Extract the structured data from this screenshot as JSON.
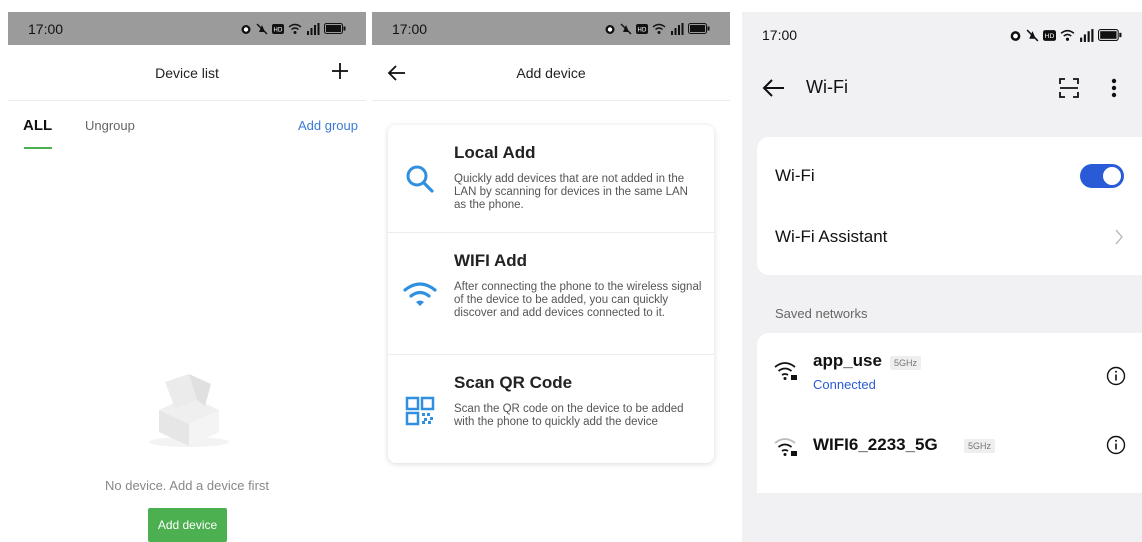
{
  "screen1": {
    "status": {
      "time": "17:00"
    },
    "header": {
      "title": "Device list"
    },
    "tabs": {
      "all": "ALL",
      "ungroup": "Ungroup",
      "add_group": "Add group"
    },
    "empty": {
      "message": "No device. Add a device first",
      "button": "Add device"
    }
  },
  "screen2": {
    "status": {
      "time": "17:00"
    },
    "header": {
      "title": "Add device"
    },
    "options": [
      {
        "title": "Local Add",
        "desc": "Quickly add devices that are not added in the LAN by scanning for devices in the same LAN as the phone.",
        "icon": "search-icon"
      },
      {
        "title": "WIFI Add",
        "desc": "After connecting the phone to the wireless signal of the device to be added, you can quickly discover and add devices connected to it.",
        "icon": "wifi-icon"
      },
      {
        "title": "Scan QR Code",
        "desc": "Scan the QR code on the device to be added with the phone to quickly add the device",
        "icon": "qr-code-icon"
      }
    ]
  },
  "screen3": {
    "status": {
      "time": "17:00"
    },
    "header": {
      "title": "Wi-Fi"
    },
    "wifi_toggle": {
      "label": "Wi-Fi",
      "on": true
    },
    "assistant": {
      "label": "Wi-Fi Assistant"
    },
    "saved_label": "Saved networks",
    "networks": [
      {
        "name": "app_use",
        "badge": "5GHz",
        "status": "Connected"
      },
      {
        "name": "WIFI6_2233_5G",
        "badge": "5GHz",
        "status": ""
      }
    ]
  },
  "colors": {
    "green": "#4caf50",
    "blue_link": "#3a7bd5",
    "toggle_blue": "#2a5bd7",
    "icon_blue": "#2f8fe0"
  }
}
